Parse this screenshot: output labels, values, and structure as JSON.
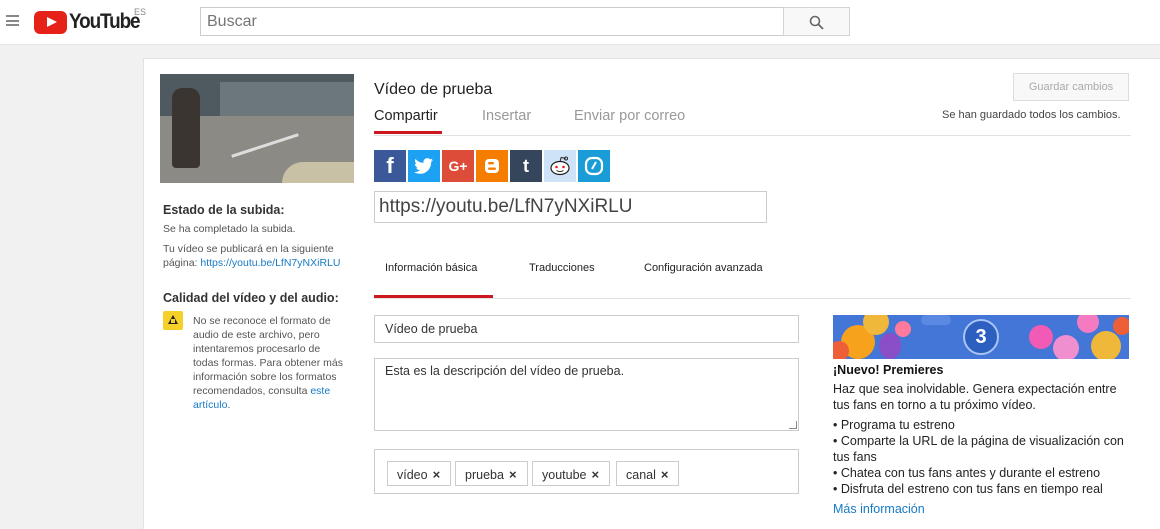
{
  "header": {
    "logo_text": "YouTube",
    "region": "ES",
    "search_placeholder": "Buscar"
  },
  "upload": {
    "video_title": "Vídeo de prueba",
    "tabs": [
      "Compartir",
      "Insertar",
      "Enviar por correo"
    ],
    "save_button": "Guardar cambios",
    "save_status": "Se han guardado todos los cambios.",
    "share_url": "https://youtu.be/LfN7yNXiRLU",
    "share_icons": [
      "facebook",
      "twitter",
      "google-plus",
      "blogger",
      "tumblr",
      "reddit",
      "nate"
    ],
    "sub_tabs": [
      "Información básica",
      "Traducciones",
      "Configuración avanzada"
    ]
  },
  "status": {
    "heading": "Estado de la subida:",
    "completed": "Se ha completado la subida.",
    "publish_text": "Tu vídeo se publicará en la siguiente página:",
    "publish_link": "https://youtu.be/LfN7yNXiRLU"
  },
  "quality": {
    "heading": "Calidad del vídeo y del audio:",
    "message": "No se reconoce el formato de audio de este archivo, pero intentaremos procesarlo de todas formas. Para obtener más información sobre los formatos recomendados, consulta",
    "link": "este artículo",
    "end": "."
  },
  "form": {
    "title_value": "Vídeo de prueba",
    "description_value": "Esta es la descripción del vídeo de prueba.",
    "tags": [
      "vídeo",
      "prueba",
      "youtube",
      "canal"
    ],
    "tag_remove": "×"
  },
  "promo": {
    "badge": "3",
    "title": "¡Nuevo! Premieres",
    "text": "Haz que sea inolvidable. Genera expectación entre tus fans en torno a tu próximo vídeo.",
    "items": [
      "• Programa tu estreno",
      "• Comparte la URL de la página de visualización con tus fans",
      "• Chatea con tus fans antes y durante el estreno",
      "• Disfruta del estreno con tus fans en tiempo real"
    ],
    "more_link": "Más información"
  }
}
